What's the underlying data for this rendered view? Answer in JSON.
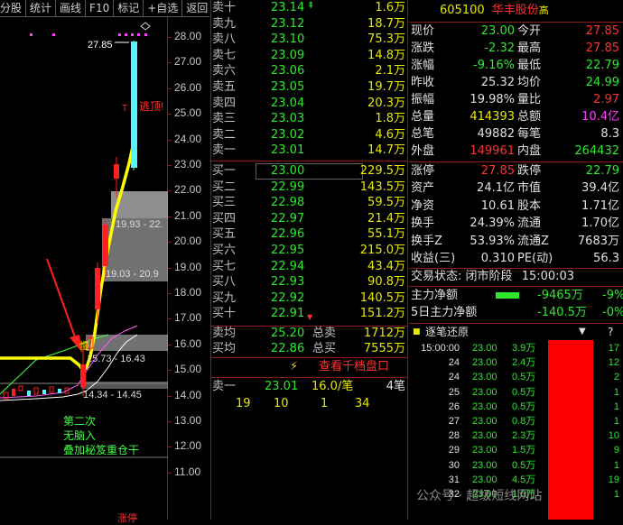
{
  "toolbar": [
    "分股",
    "统计",
    "画线",
    "F10",
    "标记",
    "+自选",
    "返回"
  ],
  "chart": {
    "yticks": [
      "28.00",
      "27.00",
      "26.00",
      "25.00",
      "24.00",
      "23.00",
      "22.00",
      "21.00",
      "20.00",
      "19.00",
      "18.00",
      "17.00",
      "16.00",
      "15.00",
      "14.00",
      "13.00",
      "12.00",
      "11.00"
    ],
    "high_label": "27.85",
    "escape_label": "逃顶!",
    "box_label_1": "19.93 - 22.",
    "box_label_2": "19.03 - 20.9",
    "box_label_3": "15.73 - 16.43",
    "box_label_4": "14.34 - 14.45",
    "t_marker": "T",
    "mark_small": "慢",
    "note_lines": [
      "第二次",
      "无脑入",
      "叠加秘笈重仓干"
    ],
    "bottom_label": "涨停",
    "colors": {
      "ma_yellow": "#ffff00",
      "candle_cyan": "#56f5ff",
      "candle_red": "#ff2020",
      "arrow_red": "#ff2020"
    }
  },
  "book": {
    "sell": [
      {
        "label": "卖十",
        "price": "23.14",
        "vol": "1.6万"
      },
      {
        "label": "卖九",
        "price": "23.12",
        "vol": "18.7万"
      },
      {
        "label": "卖八",
        "price": "23.10",
        "vol": "75.3万"
      },
      {
        "label": "卖七",
        "price": "23.09",
        "vol": "14.8万"
      },
      {
        "label": "卖六",
        "price": "23.06",
        "vol": "2.1万"
      },
      {
        "label": "卖五",
        "price": "23.05",
        "vol": "19.7万"
      },
      {
        "label": "卖四",
        "price": "23.04",
        "vol": "20.3万"
      },
      {
        "label": "卖三",
        "price": "23.03",
        "vol": "1.8万"
      },
      {
        "label": "卖二",
        "price": "23.02",
        "vol": "4.6万"
      },
      {
        "label": "卖一",
        "price": "23.01",
        "vol": "14.7万"
      }
    ],
    "buy": [
      {
        "label": "买一",
        "price": "23.00",
        "vol": "229.5万"
      },
      {
        "label": "买二",
        "price": "22.99",
        "vol": "143.5万"
      },
      {
        "label": "买三",
        "price": "22.98",
        "vol": "59.5万"
      },
      {
        "label": "买四",
        "price": "22.97",
        "vol": "21.4万"
      },
      {
        "label": "买五",
        "price": "22.96",
        "vol": "55.1万"
      },
      {
        "label": "买六",
        "price": "22.95",
        "vol": "215.0万"
      },
      {
        "label": "买七",
        "price": "22.94",
        "vol": "43.4万"
      },
      {
        "label": "买八",
        "price": "22.93",
        "vol": "90.8万"
      },
      {
        "label": "买九",
        "price": "22.92",
        "vol": "140.5万"
      },
      {
        "label": "买十",
        "price": "22.91",
        "vol": "151.2万"
      }
    ],
    "sell_avg_label": "卖均",
    "sell_avg": "25.20",
    "sell_total_label": "总卖",
    "sell_total": "1712万",
    "buy_avg_label": "买均",
    "buy_avg": "22.86",
    "buy_total_label": "总买",
    "buy_total": "7555万",
    "depth_button": "查看千档盘口",
    "queue_label": "卖一",
    "queue_price": "23.01",
    "queue_avg": "16.0/笔",
    "queue_count": "4笔",
    "queue_items": [
      "19",
      "10",
      "1",
      "34"
    ]
  },
  "panel": {
    "code": "605100",
    "name": "华丰股份",
    "tag": "高",
    "quote_left": [
      {
        "l": "现价",
        "v": "23.00",
        "c": "grn"
      },
      {
        "l": "涨跌",
        "v": "-2.32",
        "c": "grn"
      },
      {
        "l": "涨幅",
        "v": "-9.16%",
        "c": "grn"
      },
      {
        "l": "昨收",
        "v": "25.32",
        "c": "wht"
      },
      {
        "l": "振幅",
        "v": "19.98%",
        "c": "wht"
      },
      {
        "l": "总量",
        "v": "414393",
        "c": "yel"
      },
      {
        "l": "总笔",
        "v": "49882",
        "c": "wht"
      },
      {
        "l": "外盘",
        "v": "149961",
        "c": "red"
      }
    ],
    "quote_right": [
      {
        "l": "今开",
        "v": "27.85",
        "c": "red"
      },
      {
        "l": "最高",
        "v": "27.85",
        "c": "red"
      },
      {
        "l": "最低",
        "v": "22.79",
        "c": "grn"
      },
      {
        "l": "均价",
        "v": "24.99",
        "c": "grn"
      },
      {
        "l": "量比",
        "v": "2.97",
        "c": "red"
      },
      {
        "l": "总额",
        "v": "10.4亿",
        "c": "mag"
      },
      {
        "l": "每笔",
        "v": "8.3",
        "c": "wht"
      },
      {
        "l": "内盘",
        "v": "264432",
        "c": "grn"
      }
    ],
    "fund_left": [
      {
        "l": "涨停",
        "v": "27.85",
        "c": "red"
      },
      {
        "l": "资产",
        "v": "24.1亿",
        "c": "wht"
      },
      {
        "l": "净资",
        "v": "10.61",
        "c": "wht"
      },
      {
        "l": "换手",
        "v": "24.39%",
        "c": "wht"
      },
      {
        "l": "换手Z",
        "v": "53.93%",
        "c": "wht"
      },
      {
        "l": "收益(三)",
        "v": "0.310",
        "c": "wht"
      }
    ],
    "fund_right": [
      {
        "l": "跌停",
        "v": "22.79",
        "c": "grn"
      },
      {
        "l": "市值",
        "v": "39.4亿",
        "c": "wht"
      },
      {
        "l": "股本",
        "v": "1.71亿",
        "c": "wht"
      },
      {
        "l": "流通",
        "v": "1.70亿",
        "c": "wht"
      },
      {
        "l": "流通Z",
        "v": "7683万",
        "c": "wht"
      },
      {
        "l": "PE(动)",
        "v": "56.3",
        "c": "wht"
      }
    ],
    "status_label": "交易状态:",
    "status_value": "闭市阶段",
    "status_time": "15:00:03",
    "flow1_label": "主力净额",
    "flow1_value": "-9465万",
    "flow1_pct": "-9%",
    "flow2_label": "5日主力净额",
    "flow2_value": "-140.5万",
    "flow2_pct": "-0%",
    "ticks_title": "逐笔还原",
    "ticks_question": "?",
    "ticks": [
      {
        "t": "15:00:00",
        "p": "23.00",
        "v": "3.9万",
        "n": "17"
      },
      {
        "t": "24",
        "p": "23.00",
        "v": "2.4万",
        "n": "12"
      },
      {
        "t": "24",
        "p": "23.00",
        "v": "0.5万",
        "n": "2"
      },
      {
        "t": "25",
        "p": "23.00",
        "v": "0.5万",
        "n": "1"
      },
      {
        "t": "26",
        "p": "23.00",
        "v": "0.5万",
        "n": "1"
      },
      {
        "t": "27",
        "p": "23.00",
        "v": "0.8万",
        "n": "1"
      },
      {
        "t": "28",
        "p": "23.00",
        "v": "2.3万",
        "n": "10"
      },
      {
        "t": "29",
        "p": "23.00",
        "v": "1.5万",
        "n": "9"
      },
      {
        "t": "30",
        "p": "23.00",
        "v": "0.5万",
        "n": "1"
      },
      {
        "t": "31",
        "p": "23.00",
        "v": "4.5万",
        "n": "19"
      },
      {
        "t": "32",
        "p": "23.00",
        "v": "1.0万",
        "n": "1"
      }
    ],
    "watermark": "公众号 · 超级短线网站"
  }
}
